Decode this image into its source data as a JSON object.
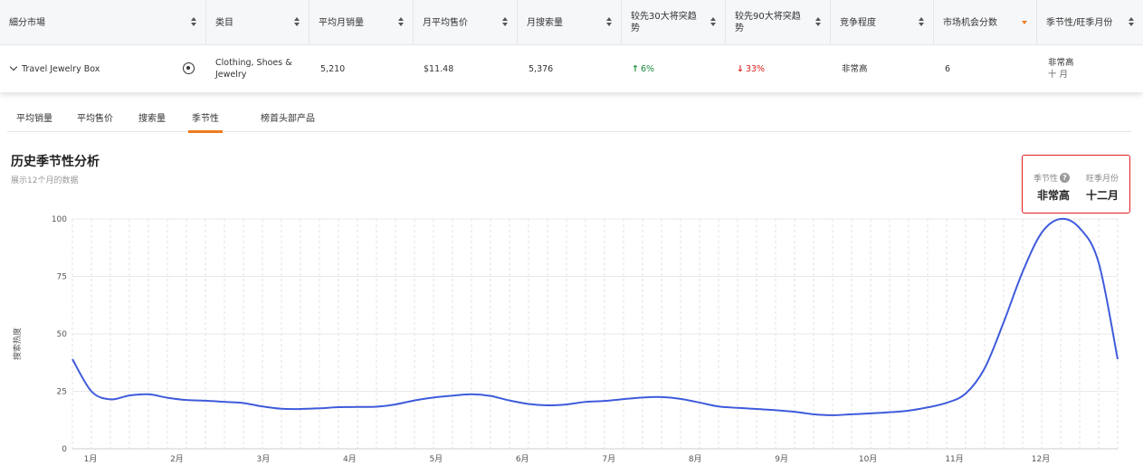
{
  "table": {
    "headers": [
      {
        "label": "細分市場",
        "sort": "both"
      },
      {
        "label": "类目",
        "sort": "both"
      },
      {
        "label": "平均月销量",
        "sort": "both"
      },
      {
        "label": "月平均售价",
        "sort": "both"
      },
      {
        "label": "月搜索量",
        "sort": "both"
      },
      {
        "label": "较先30大将突趋势",
        "sort": "both"
      },
      {
        "label": "较先90大将突趋势",
        "sort": "both"
      },
      {
        "label": "竞争程度",
        "sort": "both"
      },
      {
        "label": "市场机会分数",
        "sort": "desc"
      },
      {
        "label": "季节性/旺季月份",
        "sort": "both"
      }
    ],
    "row": {
      "niche": "Travel Jewelry Box",
      "category": "Clothing, Shoes & Jewelry",
      "avg_monthly_sales": "5,210",
      "avg_price": "$11.48",
      "monthly_search": "5,376",
      "trend_30": "6%",
      "trend_90": "33%",
      "competition": "非常高",
      "opportunity_score": "6",
      "seasonality": "非常高",
      "peak_month": "十 月"
    }
  },
  "tabs": [
    {
      "label": "平均销量",
      "active": false
    },
    {
      "label": "平均售价",
      "active": false
    },
    {
      "label": "搜索量",
      "active": false
    },
    {
      "label": "季节性",
      "active": true
    },
    {
      "label": "榜首头部产品",
      "active": false
    }
  ],
  "section": {
    "title": "历史季节性分析",
    "subtitle": "展示12个月的数据"
  },
  "summary": {
    "seasonality_label": "季节性",
    "seasonality_value": "非常高",
    "peak_label": "旺季月份",
    "peak_value": "十二月",
    "help_icon": "question-circle-icon"
  },
  "colors": {
    "accent": "#f07b1d",
    "line": "#3f5bdb",
    "up": "#1a8a3a",
    "down": "#e02020"
  },
  "chart_data": {
    "type": "line",
    "title": "",
    "ylabel": "搜索热度",
    "xlabel": "",
    "ylim": [
      0,
      100
    ],
    "yticks": [
      0,
      25,
      50,
      75,
      100
    ],
    "xtick_labels": [
      "1月",
      "2月",
      "3月",
      "4月",
      "5月",
      "6月",
      "7月",
      "8月",
      "9月",
      "10月",
      "11月",
      "12月"
    ],
    "grid": true,
    "series": [
      {
        "values": [
          39,
          25,
          21.5,
          23.2,
          23.7,
          22.2,
          21.2,
          20.9,
          20.4,
          19.9,
          18.4,
          17.4,
          17.3,
          17.6,
          18.1,
          18.2,
          18.3,
          19.3,
          21,
          22.3,
          23.1,
          23.7,
          23,
          21,
          19.5,
          18.9,
          19.3,
          20.4,
          20.8,
          21.6,
          22.3,
          22.5,
          21.7,
          20.1,
          18.4,
          17.8,
          17.3,
          16.8,
          16.1,
          15,
          14.6,
          15,
          15.4,
          15.9,
          16.6,
          18,
          20,
          24,
          35,
          55,
          77,
          94,
          100,
          96,
          81,
          39
        ]
      }
    ]
  }
}
